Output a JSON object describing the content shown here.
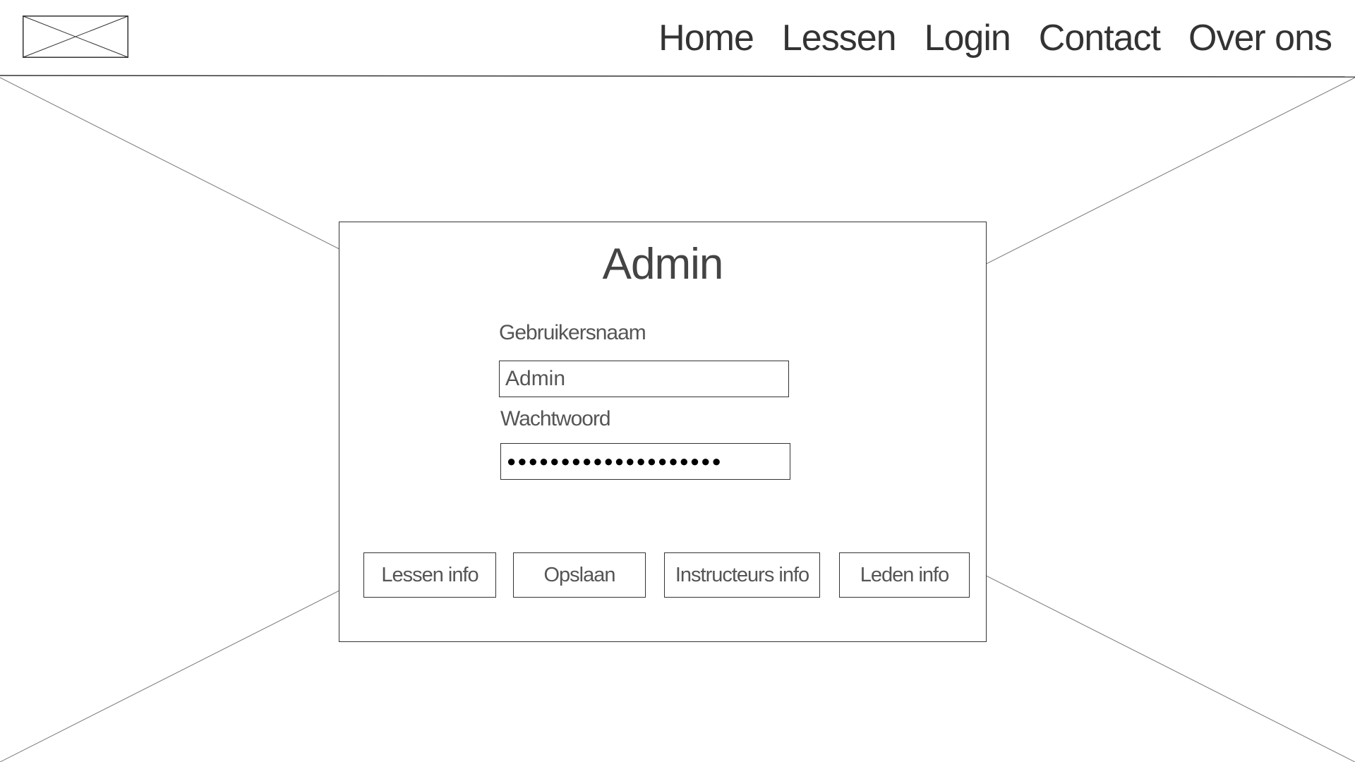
{
  "header": {
    "logo_icon": "image-placeholder-icon",
    "nav": [
      {
        "label": "Home"
      },
      {
        "label": "Lessen"
      },
      {
        "label": "Login"
      },
      {
        "label": "Contact"
      },
      {
        "label": "Over ons"
      }
    ]
  },
  "background": {
    "icon": "image-placeholder-icon"
  },
  "admin_panel": {
    "title": "Admin",
    "username_label": "Gebruikersnaam",
    "username_value": "Admin",
    "password_label": "Wachtwoord",
    "password_value": "●●●●●●●●●●●●●●●●●●●●",
    "buttons": {
      "lessen_info": "Lessen info",
      "opslaan": "Opslaan",
      "instructeurs_info": "Instructeurs info",
      "leden_info": "Leden info"
    }
  },
  "colors": {
    "line": "#333333",
    "text": "#555555",
    "background": "#ffffff"
  }
}
